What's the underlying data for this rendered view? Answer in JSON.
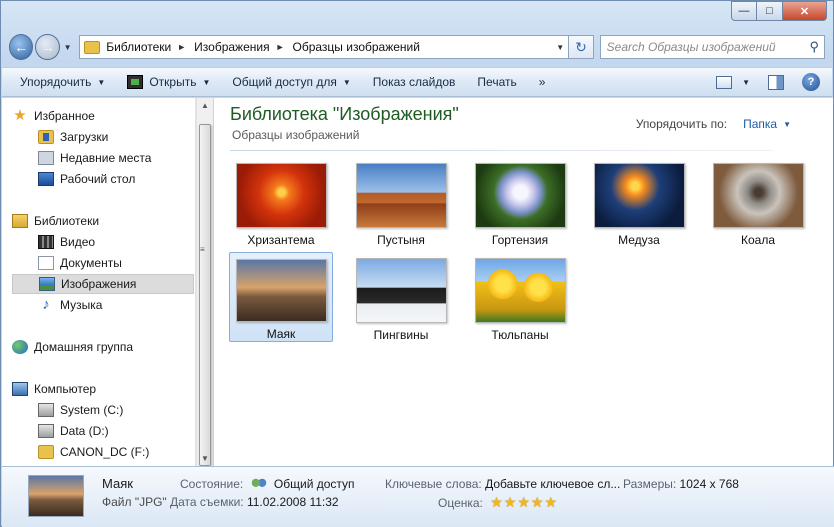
{
  "address": {
    "crumbs": [
      "Библиотеки",
      "Изображения",
      "Образцы изображений"
    ]
  },
  "search": {
    "placeholder": "Search Образцы изображений"
  },
  "commands": {
    "arrange": "Упорядочить",
    "open": "Открыть",
    "share": "Общий доступ для",
    "slideshow": "Показ слайдов",
    "print": "Печать",
    "more": "»"
  },
  "nav": {
    "favorites": "Избранное",
    "downloads": "Загрузки",
    "recent": "Недавние места",
    "desktop": "Рабочий стол",
    "libraries": "Библиотеки",
    "video": "Видео",
    "documents": "Документы",
    "images": "Изображения",
    "music": "Музыка",
    "homegroup": "Домашняя группа",
    "computer": "Компьютер",
    "drive_c": "System (C:)",
    "drive_d": "Data (D:)",
    "drive_f": "CANON_DC (F:)"
  },
  "content": {
    "title": "Библиотека \"Изображения\"",
    "subtitle": "Образцы изображений",
    "arrange_label": "Упорядочить по:",
    "arrange_value": "Папка",
    "items": [
      "Хризантема",
      "Пустыня",
      "Гортензия",
      "Медуза",
      "Коала",
      "Маяк",
      "Пингвины",
      "Тюльпаны"
    ]
  },
  "details": {
    "name": "Маяк",
    "type": "Файл \"JPG\"",
    "state_label": "Состояние:",
    "state_value": "Общий доступ",
    "date_label": "Дата съемки:",
    "date_value": "11.02.2008 11:32",
    "keywords_label": "Ключевые слова:",
    "keywords_value": "Добавьте ключевое сл...",
    "size_label": "Размеры:",
    "size_value": "1024 x 768",
    "rating_label": "Оценка:",
    "rating_stars": 5
  },
  "colors": {
    "title_green": "#1e5b23",
    "link_blue": "#1f5aa6",
    "selection": "#cfe2f6"
  }
}
